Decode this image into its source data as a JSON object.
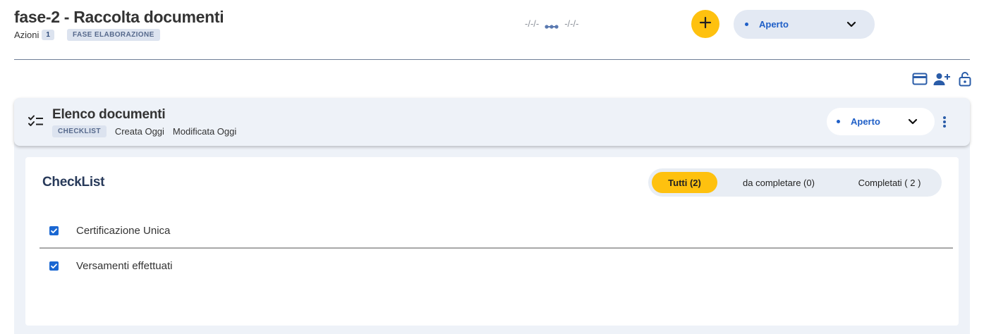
{
  "header": {
    "title": "fase-2 - Raccolta documenti",
    "actions_label": "Azioni",
    "actions_count": "1",
    "phase_tag": "FASE ELABORAZIONE",
    "start_date": "-/-/-",
    "end_date": "-/-/-",
    "add_button_icon": "plus-icon",
    "status": "Aperto"
  },
  "toolbar": {
    "icons": [
      "card-icon",
      "add-person-icon",
      "lock-open-icon"
    ]
  },
  "card": {
    "icon": "checklist-icon",
    "title": "Elenco documenti",
    "tag": "CHECKLIST",
    "created": "Creata Oggi",
    "modified": "Modificata Oggi",
    "status": "Aperto"
  },
  "checklist": {
    "title": "CheckList",
    "tabs": [
      {
        "label": "Tutti (2)",
        "active": true
      },
      {
        "label": "da completare (0)",
        "active": false
      },
      {
        "label": "Completati ( 2 )",
        "active": false
      }
    ],
    "items": [
      {
        "label": "Certificazione Unica",
        "checked": true
      },
      {
        "label": "Versamenti effettuati",
        "checked": true
      }
    ]
  },
  "colors": {
    "accent_yellow": "#fec10f",
    "primary_blue": "#1f5fc7",
    "checkbox_blue": "#1a67d2",
    "panel_bg": "#eef2f8",
    "tag_bg": "#dce3ef"
  }
}
